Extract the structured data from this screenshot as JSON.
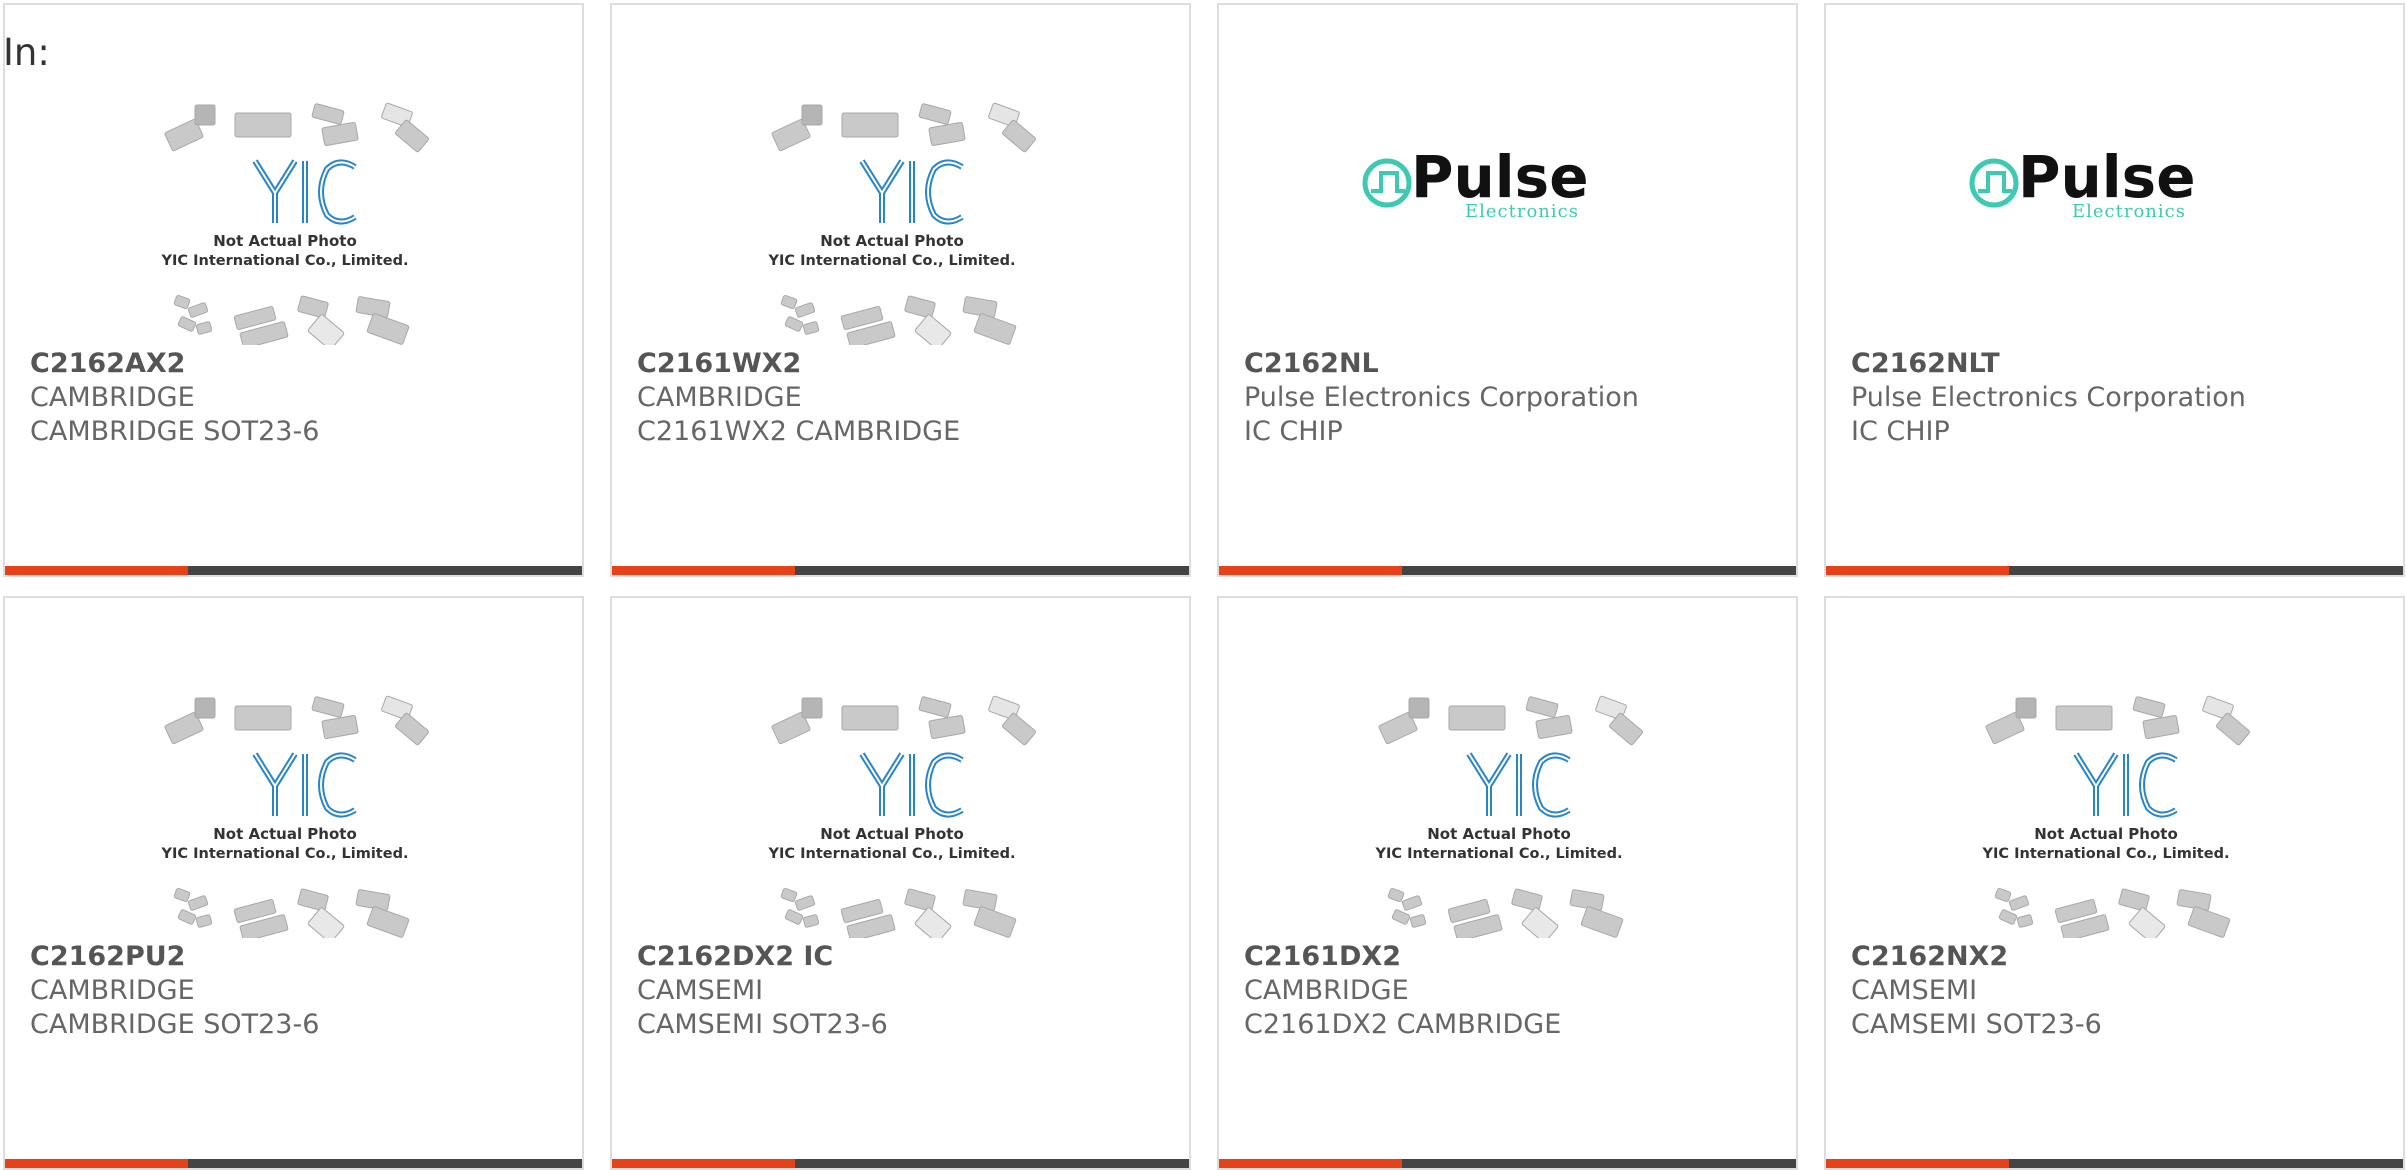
{
  "prefix_label": "In:",
  "colors": {
    "accent": "#e5421a",
    "bar_dark": "#444444",
    "yic_blue": "#2a85c8",
    "pulse_teal": "#3ec9b3",
    "chip_gray": "#c9c9c9"
  },
  "thumbnails": {
    "yic": {
      "line1": "Not Actual Photo",
      "line2": "YIC International Co., Limited.",
      "logo": "YIC"
    },
    "pulse": {
      "name": "Pulse",
      "sub": "Electronics"
    }
  },
  "products": [
    {
      "part": "C2162AX2",
      "maker": "CAMBRIDGE",
      "desc": "CAMBRIDGE SOT23-6",
      "image": "yic-placeholder"
    },
    {
      "part": "C2161WX2",
      "maker": "CAMBRIDGE",
      "desc": "C2161WX2 CAMBRIDGE",
      "image": "yic-placeholder"
    },
    {
      "part": "C2162NL",
      "maker": "Pulse Electronics Corporation",
      "desc": "IC CHIP",
      "image": "pulse-logo"
    },
    {
      "part": "C2162NLT",
      "maker": "Pulse Electronics Corporation",
      "desc": "IC CHIP",
      "image": "pulse-logo"
    },
    {
      "part": "C2162PU2",
      "maker": "CAMBRIDGE",
      "desc": "CAMBRIDGE SOT23-6",
      "image": "yic-placeholder"
    },
    {
      "part": "C2162DX2 IC",
      "maker": "CAMSEMI",
      "desc": "CAMSEMI SOT23-6",
      "image": "yic-placeholder"
    },
    {
      "part": "C2161DX2",
      "maker": "CAMBRIDGE",
      "desc": "C2161DX2 CAMBRIDGE",
      "image": "yic-placeholder"
    },
    {
      "part": "C2162NX2",
      "maker": "CAMSEMI",
      "desc": "CAMSEMI SOT23-6",
      "image": "yic-placeholder"
    }
  ]
}
